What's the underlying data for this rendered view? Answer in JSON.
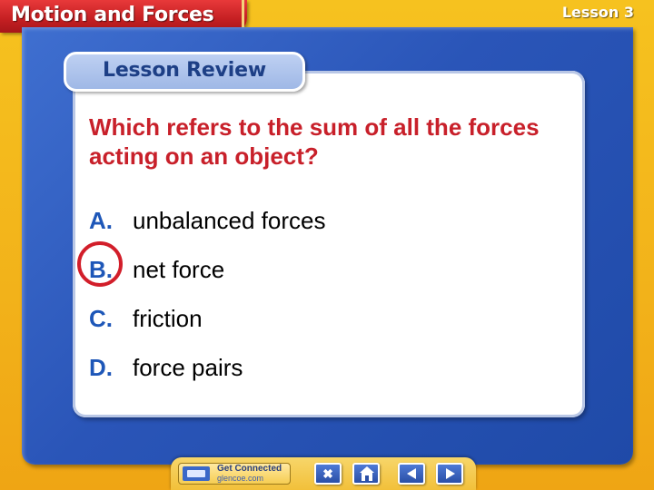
{
  "header": {
    "title": "Motion and Forces",
    "lesson": "Lesson 3"
  },
  "panel": {
    "banner": "Lesson Review",
    "question": "Which refers to the sum of all the forces acting on an object?",
    "options": [
      {
        "letter": "A.",
        "text": "unbalanced forces"
      },
      {
        "letter": "B.",
        "text": "net force"
      },
      {
        "letter": "C.",
        "text": "friction"
      },
      {
        "letter": "D.",
        "text": "force pairs"
      }
    ],
    "correct_option": "B."
  },
  "nav": {
    "get_connected_label": "Get Connected",
    "get_connected_url": "glencoe.com",
    "buttons": [
      {
        "name": "close",
        "icon": "close-icon",
        "glyph": "✖"
      },
      {
        "name": "home",
        "icon": "home-icon"
      },
      {
        "name": "previous",
        "icon": "arrow-left-icon"
      },
      {
        "name": "next",
        "icon": "arrow-right-icon"
      }
    ]
  },
  "colors": {
    "background": "#f2b21a",
    "header": "#c41f22",
    "frame": "#2a55b8",
    "question_text": "#c8202a",
    "option_letter": "#1e57b8",
    "answer_ring": "#d21e2a"
  }
}
